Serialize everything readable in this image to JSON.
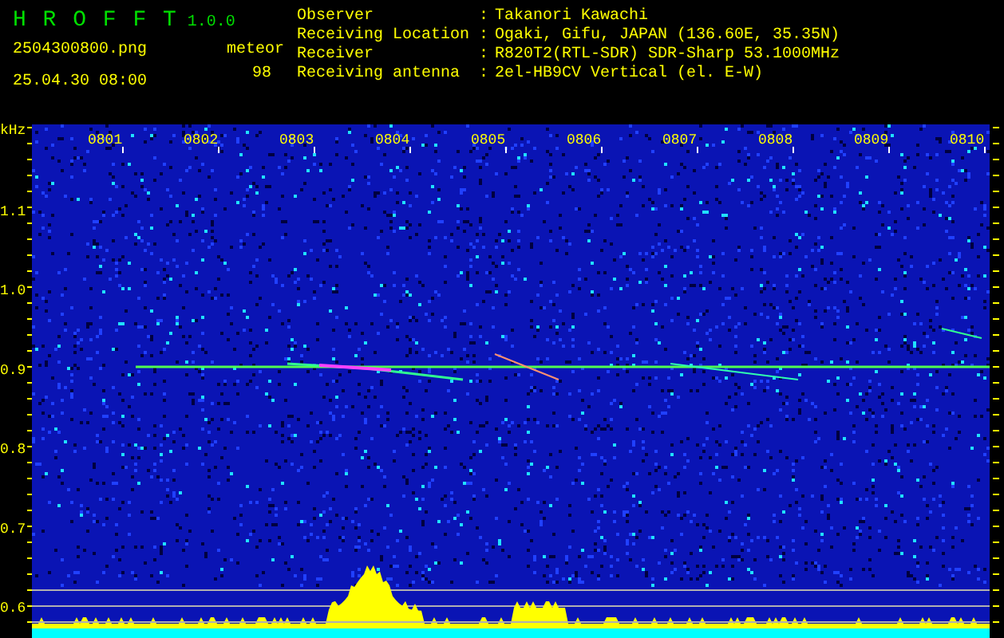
{
  "app": {
    "title": "H R O F F T",
    "version": "1.0.0"
  },
  "file_name": "2504300800.png",
  "date_time": "25.04.30 08:00",
  "meteor": {
    "label": "meteor",
    "count": "98"
  },
  "station": {
    "separator": ":",
    "rows": [
      {
        "label": "Observer",
        "value": "Takanori Kawachi"
      },
      {
        "label": "Receiving Location",
        "value": "Ogaki, Gifu, JAPAN (136.60E, 35.35N)"
      },
      {
        "label": "Receiver",
        "value": "R820T2(RTL-SDR) SDR-Sharp 53.1000MHz"
      },
      {
        "label": "Receiving antenna",
        "value": "2el-HB9CV Vertical (el. E-W)"
      }
    ]
  },
  "spectrogram": {
    "frequency_unit": "kHz",
    "time_labels": [
      "0801",
      "0802",
      "0803",
      "0804",
      "0805",
      "0806",
      "0807",
      "0808",
      "0809",
      "0810"
    ],
    "frequency_labels": [
      "1.1",
      "1.0",
      "0.9",
      "0.8",
      "0.7",
      "0.6"
    ]
  }
}
